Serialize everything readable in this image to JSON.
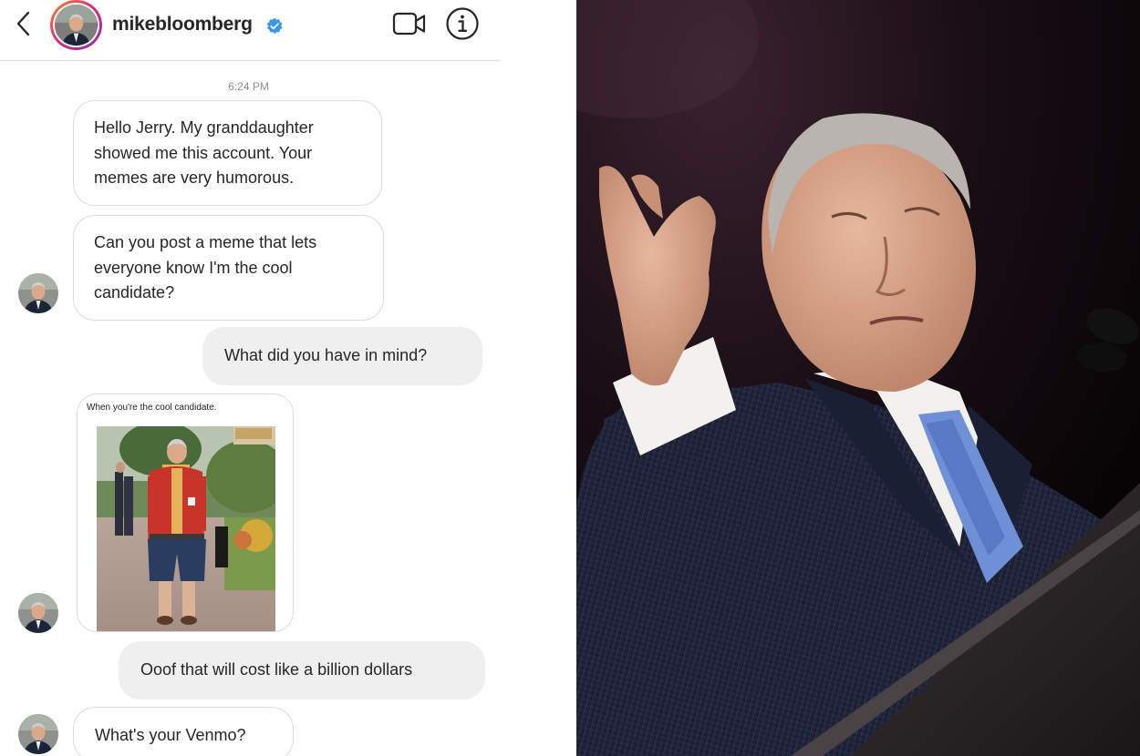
{
  "dm": {
    "username": "mikebloomberg",
    "timestamp": "6:24 PM",
    "messages": [
      {
        "id": "m1",
        "direction": "incoming",
        "text": "Hello Jerry. My granddaughter\nshowed me this account. Your\nmemes are very humorous."
      },
      {
        "id": "m2",
        "direction": "incoming",
        "text": "Can you post a meme that lets\neveryone know I'm the cool\ncandidate?"
      },
      {
        "id": "m3",
        "direction": "outgoing",
        "text": "What did you have in mind?"
      },
      {
        "id": "m4",
        "direction": "incoming",
        "type": "image",
        "caption": "When you're the cool candidate."
      },
      {
        "id": "m5",
        "direction": "outgoing",
        "text": "Ooof that will cost like a billion dollars"
      },
      {
        "id": "m6",
        "direction": "incoming",
        "text": "What's your Venmo?"
      }
    ],
    "icons": {
      "back": "chevron-left-icon",
      "verified": "verified-badge-icon",
      "video": "video-camera-icon",
      "info": "info-icon"
    }
  },
  "colors": {
    "verified_blue": "#3897f0",
    "incoming_border": "#dbdbdb",
    "outgoing_bg": "#efefef",
    "text": "#262626",
    "muted": "#8e8e8e"
  }
}
